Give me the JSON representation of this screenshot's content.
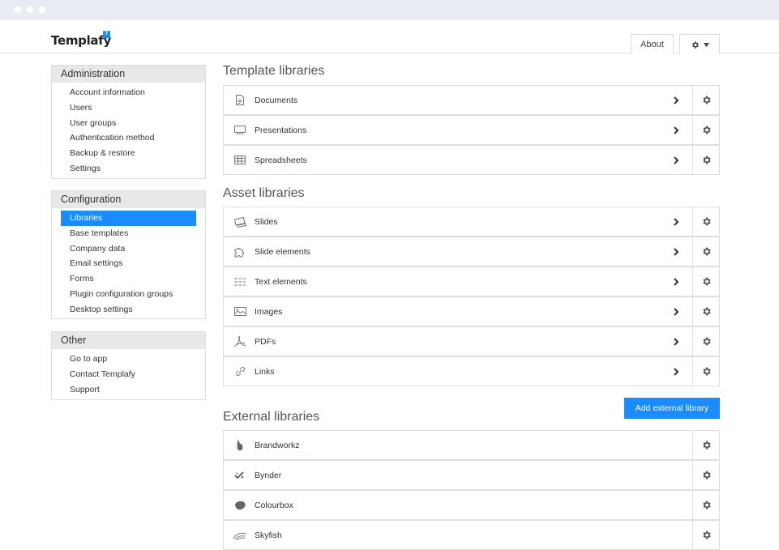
{
  "app": {
    "logo_text": "Templafy",
    "logo_badge": "T"
  },
  "header": {
    "about_label": "About"
  },
  "sidebar": {
    "administration": {
      "title": "Administration",
      "items": [
        "Account information",
        "Users",
        "User groups",
        "Authentication method",
        "Backup & restore",
        "Settings"
      ]
    },
    "configuration": {
      "title": "Configuration",
      "items": [
        "Libraries",
        "Base templates",
        "Company data",
        "Email settings",
        "Forms",
        "Plugin configuration groups",
        "Desktop settings"
      ],
      "active": "Libraries"
    },
    "other": {
      "title": "Other",
      "items": [
        "Go to app",
        "Contact Templafy",
        "Support"
      ]
    }
  },
  "main": {
    "template_libraries": {
      "title": "Template libraries",
      "items": [
        {
          "label": "Documents",
          "icon": "document-icon"
        },
        {
          "label": "Presentations",
          "icon": "presentation-icon"
        },
        {
          "label": "Spreadsheets",
          "icon": "spreadsheet-icon"
        }
      ]
    },
    "asset_libraries": {
      "title": "Asset libraries",
      "items": [
        {
          "label": "Slides",
          "icon": "slides-icon"
        },
        {
          "label": "Slide elements",
          "icon": "puzzle-icon"
        },
        {
          "label": "Text elements",
          "icon": "text-lines-icon"
        },
        {
          "label": "Images",
          "icon": "image-icon"
        },
        {
          "label": "PDFs",
          "icon": "pdf-icon"
        },
        {
          "label": "Links",
          "icon": "link-icon"
        }
      ]
    },
    "external_libraries": {
      "title": "External libraries",
      "add_button_label": "Add external library",
      "items": [
        {
          "label": "Brandworkz",
          "icon": "brandworkz-icon"
        },
        {
          "label": "Bynder",
          "icon": "bynder-icon"
        },
        {
          "label": "Colourbox",
          "icon": "colourbox-icon"
        },
        {
          "label": "Skyfish",
          "icon": "skyfish-icon"
        }
      ]
    }
  },
  "colors": {
    "accent": "#1a8cff",
    "panel_header": "#e8e8e8",
    "border": "#dedede"
  }
}
